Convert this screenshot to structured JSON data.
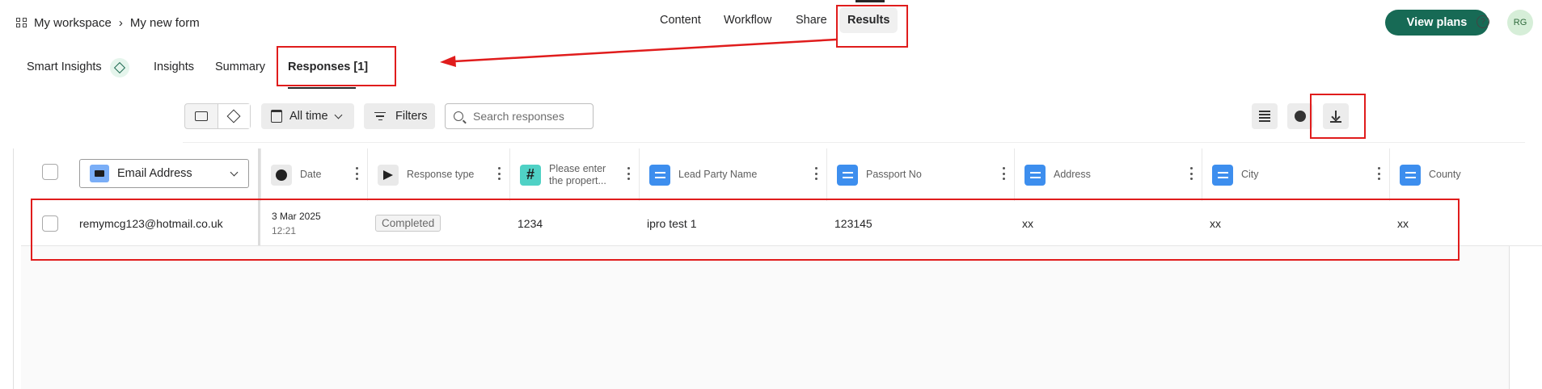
{
  "breadcrumb": {
    "workspace": "My workspace",
    "separator": "›",
    "form": "My new form"
  },
  "nav": {
    "content": "Content",
    "workflow": "Workflow",
    "share": "Share",
    "results": "Results"
  },
  "header": {
    "view_plans": "View plans",
    "help": "?",
    "avatar_initials": "RG"
  },
  "subtabs": {
    "smart_insights": "Smart Insights",
    "insights": "Insights",
    "summary": "Summary",
    "responses": "Responses [1]"
  },
  "toolbar": {
    "date_filter": "All time",
    "filters": "Filters",
    "search_placeholder": "Search responses"
  },
  "table": {
    "first_column_selector": "Email Address",
    "columns": [
      {
        "label": "Date",
        "icon": "clock-icon"
      },
      {
        "label": "Response type",
        "icon": "send-icon"
      },
      {
        "label": "Please enter the propert...",
        "icon": "hash-icon"
      },
      {
        "label": "Lead Party Name",
        "icon": "short-text-icon"
      },
      {
        "label": "Passport No",
        "icon": "short-text-icon"
      },
      {
        "label": "Address",
        "icon": "short-text-icon"
      },
      {
        "label": "City",
        "icon": "short-text-icon"
      },
      {
        "label": "County",
        "icon": "short-text-icon"
      }
    ],
    "rows": [
      {
        "email": "remymcg123@hotmail.co.uk",
        "date": "3 Mar 2025",
        "time": "12:21",
        "response_type": "Completed",
        "property": "1234",
        "lead_party_name": "ipro test 1",
        "passport_no": "123145",
        "address": "xx",
        "city": "xx",
        "county": "xx"
      }
    ]
  },
  "colors": {
    "accent": "#176a55",
    "annotation": "#e01c1c",
    "field_blue": "#3d8eee",
    "number_teal": "#4fd1c5"
  }
}
